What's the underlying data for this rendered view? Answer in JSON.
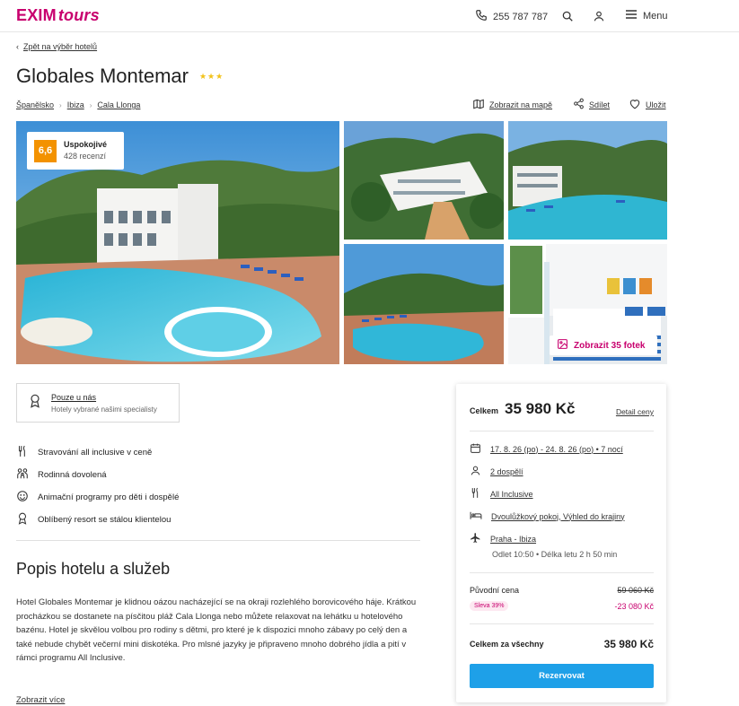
{
  "header": {
    "logo_main": "EXIM",
    "logo_sub": "tours",
    "phone": "255 787 787",
    "menu_label": "Menu",
    "brand_color": "#c8006e"
  },
  "back_link": "Zpět na výběr hotelů",
  "hotel": {
    "name": "Globales Montemar",
    "stars": 3,
    "stars_text": "★★★"
  },
  "breadcrumbs": [
    "Španělsko",
    "Ibiza",
    "Cala Llonga"
  ],
  "actions": {
    "map": "Zobrazit na mapě",
    "share": "Sdílet",
    "save": "Uložit"
  },
  "rating": {
    "score": "6,6",
    "label": "Uspokojivé",
    "reviews": "428 recenzí"
  },
  "gallery": {
    "show_all": "Zobrazit 35 fotek"
  },
  "exclusive": {
    "title": "Pouze u nás",
    "subtitle": "Hotely vybrané našimi specialisty"
  },
  "features": [
    {
      "icon": "cutlery-icon",
      "label": "Stravování all inclusive v ceně"
    },
    {
      "icon": "family-icon",
      "label": "Rodinná dovolená"
    },
    {
      "icon": "smile-icon",
      "label": "Animační programy pro děti i dospělé"
    },
    {
      "icon": "award-icon",
      "label": "Oblíbený resort se stálou klientelou"
    }
  ],
  "description": {
    "heading": "Popis hotelu a služeb",
    "text": "Hotel Globales Montemar je klidnou oázou nacházející se na okraji rozlehlého borovicového háje. Krátkou procházkou se dostanete na písčitou pláž Cala Llonga nebo můžete relaxovat na lehátku u hotelového bazénu. Hotel je skvělou volbou pro rodiny s dětmi, pro které je k dispozici mnoho zábavy po celý den a také nebude chybět večerní mini diskotéka. Pro mlsné jazyky je připraveno mnoho dobrého jídla a pití v rámci programu All Inclusive.",
    "more": "Zobrazit více"
  },
  "booking": {
    "total_label": "Celkem",
    "total_value": "35 980 Kč",
    "detail_link": "Detail ceny",
    "dates": "17. 8. 26 (po) - 24. 8. 26 (po) • 7 nocí",
    "people": "2 dospělí",
    "board": "All Inclusive",
    "room": "Dvoulůžkový pokoj, Výhled do krajiny",
    "flight": "Praha - Ibiza",
    "flight_info": "Odlet 10:50 • Délka letu 2 h 50 min",
    "original_label": "Původní cena",
    "original_value": "59 060 Kč",
    "discount_badge": "Sleva 39%",
    "discount_value": "-23 080 Kč",
    "sum_label": "Celkem za všechny",
    "sum_value": "35 980 Kč",
    "button": "Rezervovat",
    "button_color": "#1ea0e8"
  }
}
